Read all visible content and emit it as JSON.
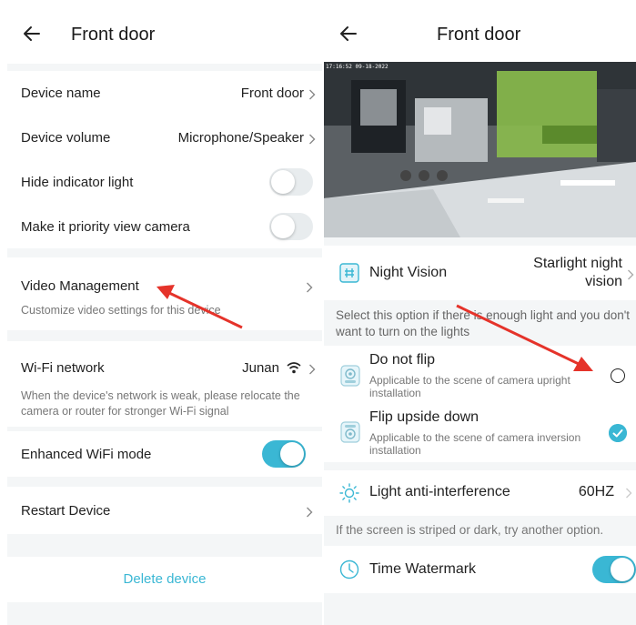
{
  "left": {
    "header": {
      "title": "Front door"
    },
    "device_name": {
      "label": "Device name",
      "value": "Front door"
    },
    "device_volume": {
      "label": "Device volume",
      "value": "Microphone/Speaker"
    },
    "hide_indicator": {
      "label": "Hide indicator light",
      "on": false
    },
    "priority_view": {
      "label": "Make it priority view camera",
      "on": false
    },
    "video_management": {
      "label": "Video Management",
      "desc": "Customize video settings for this device"
    },
    "wifi_network": {
      "label": "Wi-Fi network",
      "value": "Junan",
      "desc": "When the device's network is weak, please relocate the camera or router for stronger Wi-Fi signal"
    },
    "enhanced_wifi": {
      "label": "Enhanced WiFi mode",
      "on": true
    },
    "restart": {
      "label": "Restart Device"
    },
    "delete": {
      "label": "Delete device"
    }
  },
  "right": {
    "header": {
      "title": "Front door"
    },
    "camera": {
      "timestamp": "17:16:52 09-18-2022"
    },
    "night_vision": {
      "label": "Night Vision",
      "value_line1": "Starlight night",
      "value_line2": "vision",
      "desc": "Select this option if there is enough light and you don't want to turn on the lights"
    },
    "do_not_flip": {
      "label": "Do not flip",
      "desc": "Applicable to the scene of camera upright installation",
      "selected": false
    },
    "flip_upside_down": {
      "label": "Flip upside down",
      "desc": "Applicable to the scene of camera inversion installation",
      "selected": true
    },
    "light_anti": {
      "label": "Light anti-interference",
      "value": "60HZ",
      "desc": "If the screen is striped or dark, try another option."
    },
    "time_watermark": {
      "label": "Time Watermark",
      "on": true
    }
  },
  "colors": {
    "accent": "#3ab7d4",
    "annotation_arrow": "#e5332a",
    "background": "#f4f6f7"
  },
  "icons": [
    "back-arrow-icon",
    "chevron-right-icon",
    "wifi-icon",
    "night-vision-icon",
    "camera-upright-icon",
    "camera-inverted-icon",
    "sun-icon",
    "clock-icon",
    "check-icon"
  ]
}
